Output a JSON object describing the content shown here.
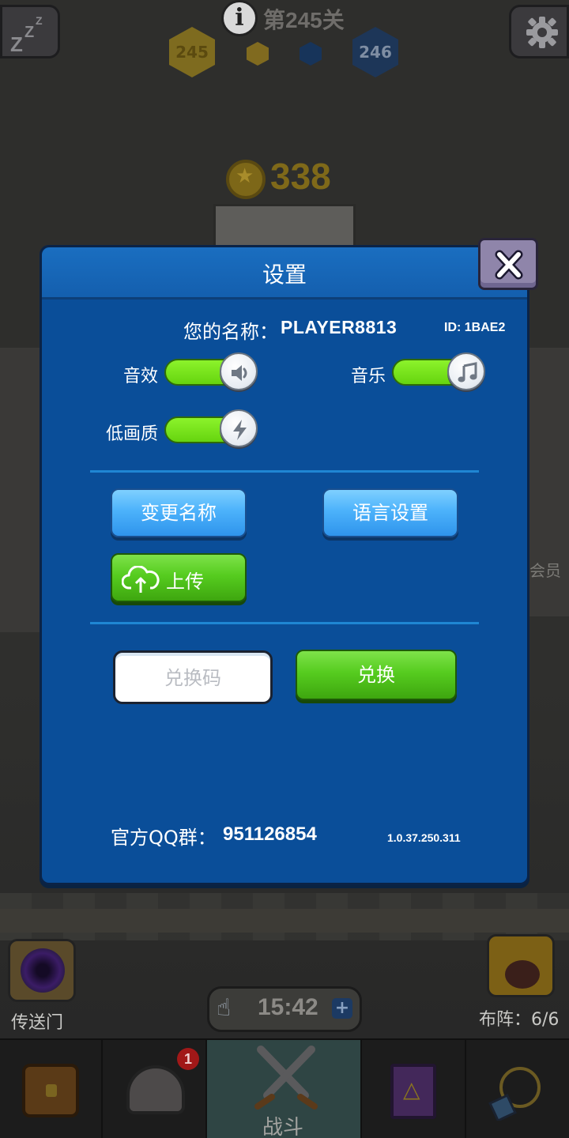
{
  "hud": {
    "level_title": "第245关",
    "level_current": "245",
    "level_next": "246",
    "coins": "338"
  },
  "background": {
    "vip_label": "会员",
    "portal_label": "传送门",
    "formation_label": "布阵：6/6",
    "timer": "15:42"
  },
  "bottom_nav": {
    "badge_count": "1",
    "battle_label": "战斗"
  },
  "settings": {
    "title": "设置",
    "name_label": "您的名称：",
    "player_name": "PLAYER8813",
    "player_id": "ID: 1BAE2",
    "sound_label": "音效",
    "music_label": "音乐",
    "low_quality_label": "低画质",
    "sound_on": true,
    "music_on": true,
    "low_quality_on": true,
    "rename_button": "变更名称",
    "language_button": "语言设置",
    "upload_button": "上传",
    "redeem_placeholder": "兑换码",
    "redeem_button": "兑换",
    "qq_label": "官方QQ群：",
    "qq_number": "951126854",
    "version": "1.0.37.250.311"
  },
  "colors": {
    "dialog_bg": "#0a4e99",
    "header_bg": "#1a6ec0",
    "toggle_on": "#7ae81e",
    "button_blue": "#4cb2fb",
    "button_green": "#56cc1f",
    "close_button": "#8f85aa"
  },
  "icons": {
    "sleep": "zzz-icon",
    "settings": "gear-icon",
    "info": "info-icon",
    "close": "close-icon",
    "sound": "speaker-icon",
    "music": "music-note-icon",
    "quality": "lightning-icon",
    "upload": "cloud-upload-icon"
  }
}
